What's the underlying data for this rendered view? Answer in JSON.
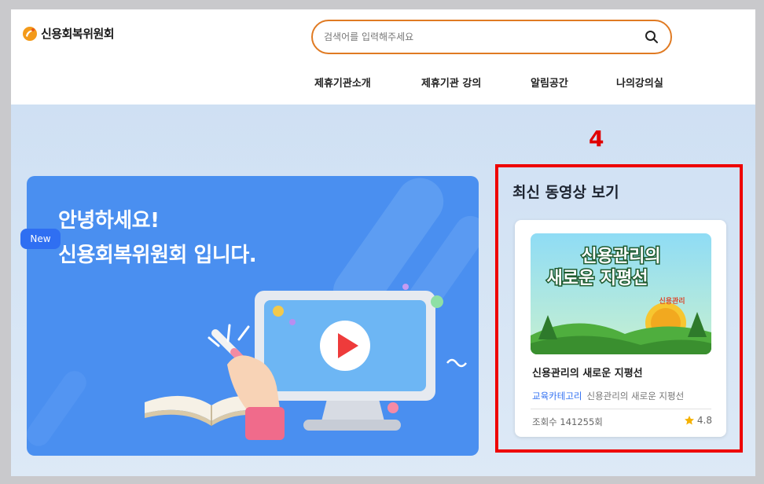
{
  "header": {
    "logo_text": "신용회복위원회",
    "search": {
      "placeholder": "검색어를 입력해주세요",
      "value": ""
    },
    "nav": [
      "제휴기관소개",
      "제휴기관 강의",
      "알림공간",
      "나의강의실"
    ]
  },
  "banner": {
    "line1": "안녕하세요!",
    "line2": "신용회복위원회 입니다."
  },
  "step_number": "4",
  "latest": {
    "title": "최신 동영상 보기",
    "card": {
      "badge": "New",
      "thumb_text_line1": "신용관리의",
      "thumb_text_line2": "새로운 지평선",
      "thumb_sticker": "신용관리",
      "title": "신용관리의 새로운 지평선",
      "category": "교육카테고리",
      "category_desc": "신용관리의 새로운 지평선",
      "views": "조회수 141255회",
      "rating": "4.8"
    }
  },
  "colors": {
    "accent_orange": "#e07a22",
    "brand_blue": "#2f6ff2",
    "banner_blue": "#4a8ff0",
    "highlight_red": "#ee0000"
  }
}
